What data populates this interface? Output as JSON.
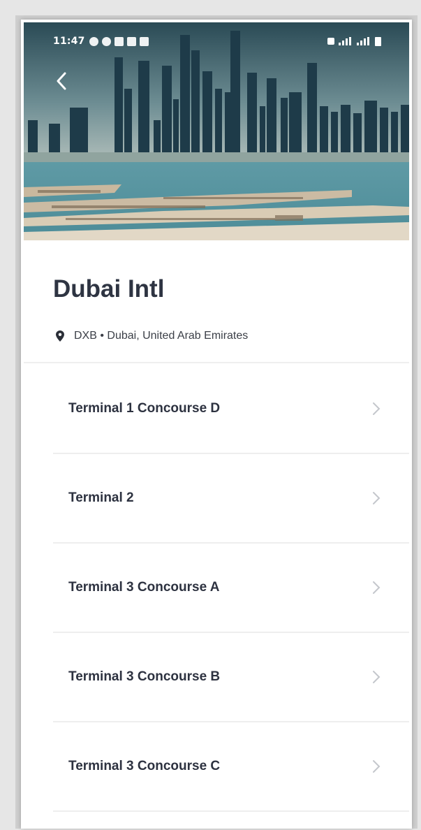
{
  "status_bar": {
    "time": "11:47",
    "left_icons": [
      "message-icon",
      "facebook-icon",
      "notes-icon",
      "instagram-icon",
      "linkedin-icon"
    ],
    "right_text": "",
    "accent": "#ffffff"
  },
  "header": {
    "back_icon": "chevron-left-icon"
  },
  "airport": {
    "name": "Dubai Intl",
    "location": "DXB • Dubai, United Arab Emirates",
    "location_icon": "map-pin-icon"
  },
  "terminals": [
    {
      "label": "Terminal 1 Concourse D"
    },
    {
      "label": "Terminal 2"
    },
    {
      "label": "Terminal 3 Concourse A"
    },
    {
      "label": "Terminal 3 Concourse B"
    },
    {
      "label": "Terminal 3 Concourse C"
    }
  ],
  "colors": {
    "title": "#2e3442",
    "text": "#2d3240",
    "chevron": "#c4c7cc",
    "divider": "#eeeeee"
  }
}
